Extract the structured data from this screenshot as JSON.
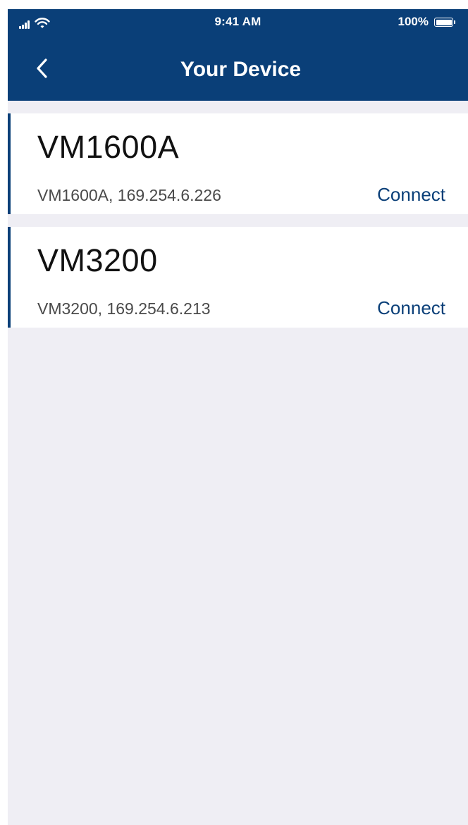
{
  "status_bar": {
    "time": "9:41 AM",
    "battery_percent": "100%",
    "signal_icon": "cellular-signal-icon",
    "wifi_icon": "wifi-icon",
    "battery_icon": "battery-icon"
  },
  "header": {
    "title": "Your Device",
    "back_icon": "chevron-left-icon",
    "background_color": "#0a3f78"
  },
  "devices": [
    {
      "name": "VM1600A",
      "address": "VM1600A, 169.254.6.226",
      "action_label": "Connect"
    },
    {
      "name": "VM3200",
      "address": "VM3200, 169.254.6.213",
      "action_label": "Connect"
    }
  ],
  "colors": {
    "accent": "#0a3f78",
    "background": "#efeef4",
    "card": "#ffffff"
  }
}
